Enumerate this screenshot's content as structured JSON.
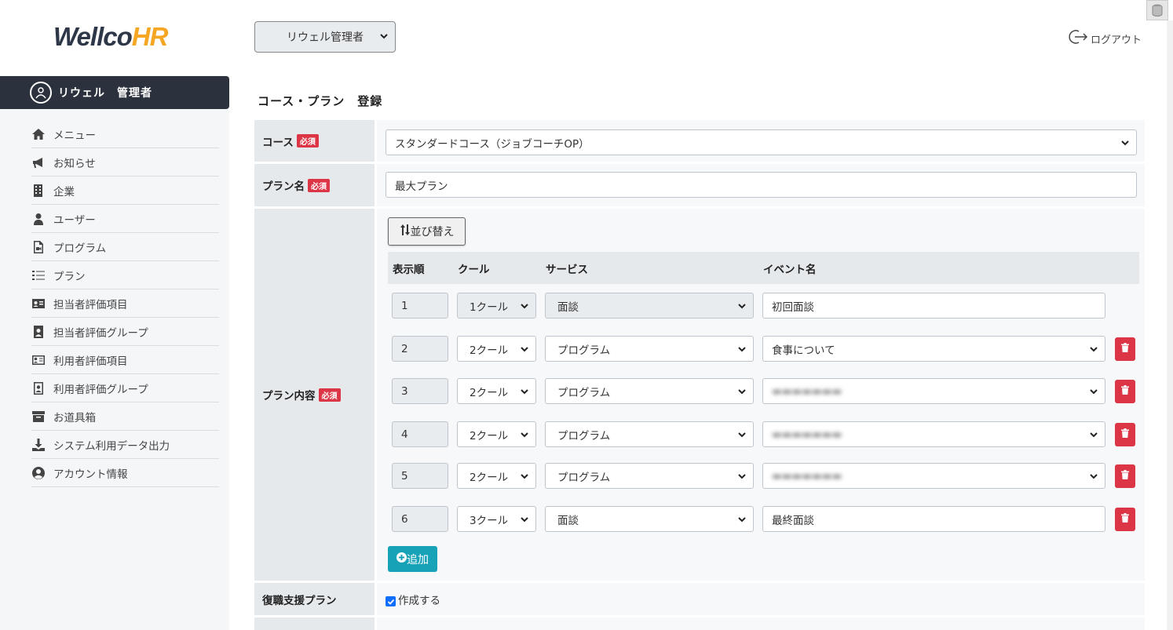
{
  "logo": {
    "part1": "Wellco",
    "part2": "HR"
  },
  "header": {
    "role_select": "リウェル管理者",
    "logout": "ログアウト"
  },
  "user": {
    "name": "リウェル　管理者"
  },
  "sidebar": {
    "items": [
      {
        "label": "メニュー",
        "icon": "home-icon"
      },
      {
        "label": "お知らせ",
        "icon": "megaphone-icon"
      },
      {
        "label": "企業",
        "icon": "building-icon"
      },
      {
        "label": "ユーザー",
        "icon": "user-icon"
      },
      {
        "label": "プログラム",
        "icon": "file-video-icon"
      },
      {
        "label": "プラン",
        "icon": "list-icon"
      },
      {
        "label": "担当者評価項目",
        "icon": "id-card-icon"
      },
      {
        "label": "担当者評価グループ",
        "icon": "user-badge-icon"
      },
      {
        "label": "利用者評価項目",
        "icon": "id-card-outline-icon"
      },
      {
        "label": "利用者評価グループ",
        "icon": "user-badge-outline-icon"
      },
      {
        "label": "お道具箱",
        "icon": "archive-icon"
      },
      {
        "label": "システム利用データ出力",
        "icon": "download-icon"
      },
      {
        "label": "アカウント情報",
        "icon": "user-circle-icon"
      }
    ]
  },
  "page": {
    "title": "コース・プラン　登録"
  },
  "form": {
    "required_badge": "必須",
    "course_label": "コース",
    "course_value": "スタンダードコース（ジョブコーチOP）",
    "plan_name_label": "プラン名",
    "plan_name_value": "最大プラン",
    "plan_content_label": "プラン内容",
    "sort_button": "並び替え",
    "columns": {
      "order": "表示順",
      "cool": "クール",
      "service": "サービス",
      "event": "イベント名"
    },
    "rows": [
      {
        "order": "1",
        "cool": "1クール",
        "service": "面談",
        "event": "初回面談",
        "blurred": false
      },
      {
        "order": "2",
        "cool": "2クール",
        "service": "プログラム",
        "event": "食事について",
        "blurred": false
      },
      {
        "order": "3",
        "cool": "2クール",
        "service": "プログラム",
        "event": "",
        "blurred": true
      },
      {
        "order": "4",
        "cool": "2クール",
        "service": "プログラム",
        "event": "",
        "blurred": true
      },
      {
        "order": "5",
        "cool": "2クール",
        "service": "プログラム",
        "event": "",
        "blurred": true
      },
      {
        "order": "6",
        "cool": "3クール",
        "service": "面談",
        "event": "最終面談",
        "blurred": false
      }
    ],
    "add_button": "追加",
    "return_plan_label": "復職支援プラン",
    "return_plan_checkbox": "作成する"
  },
  "colors": {
    "sidebar_dark": "#2b323d",
    "danger": "#dc3545",
    "info": "#17a2b8",
    "logo_accent": "#f5a623"
  }
}
